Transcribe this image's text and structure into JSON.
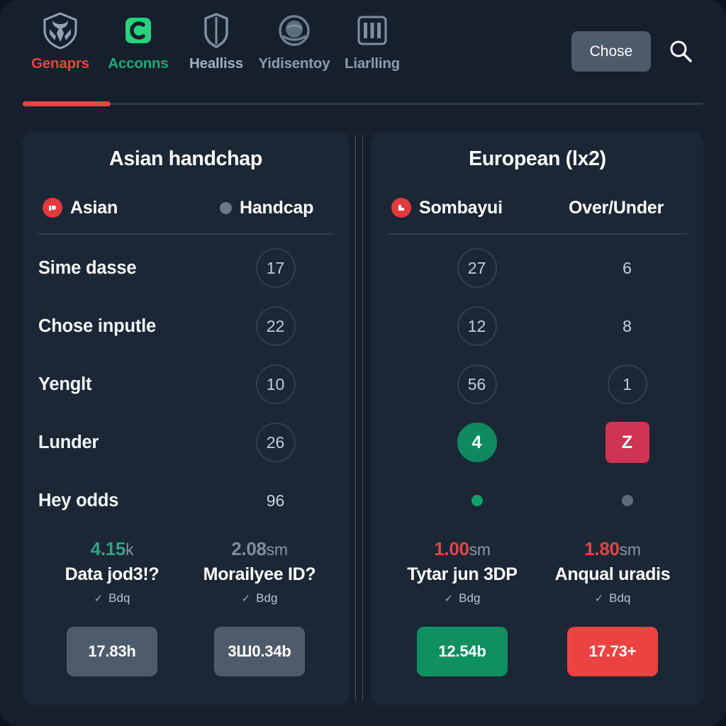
{
  "nav": {
    "tabs": [
      {
        "label": "Genaprs",
        "icon": "shield-crest-icon",
        "state": "active"
      },
      {
        "label": "Acconns",
        "icon": "letter-c-icon",
        "state": "accent"
      },
      {
        "label": "Healliss",
        "icon": "shield-outline-icon",
        "state": "plain"
      },
      {
        "label": "Yidisentoy",
        "icon": "globe-icon",
        "state": "dim"
      },
      {
        "label": "Liarlling",
        "icon": "bar-chart-icon",
        "state": "dim"
      }
    ],
    "chose_label": "Chose",
    "search_icon": "search-icon",
    "indicator_color": "#ef4440"
  },
  "panels": [
    {
      "title": "Asian handchap",
      "columns": [
        {
          "label": "Asian",
          "icon": "red-badge-icon"
        },
        {
          "label": "Handcap",
          "icon": "grey-dot-icon"
        }
      ],
      "rows": [
        {
          "label": "Sime dasse",
          "value": "17",
          "style": "circle"
        },
        {
          "label": "Chose inputle",
          "value": "22",
          "style": "circle"
        },
        {
          "label": "Yenglt",
          "value": "10",
          "style": "circle"
        },
        {
          "label": "Lunder",
          "value": "26",
          "style": "circle"
        },
        {
          "label": "Hey odds",
          "value": "96",
          "style": "plain"
        }
      ],
      "stats": [
        {
          "value": "4.15",
          "unit": "k",
          "value_color": "green",
          "title": "Data jod3!?",
          "check": "Bdq"
        },
        {
          "value": "2.08",
          "unit": "sm",
          "value_color": "grey",
          "title": "Morailyee ID?",
          "check": "Bdg"
        }
      ],
      "buttons": [
        {
          "label": "17.83h",
          "color": "grey"
        },
        {
          "label": "3Ш0.34b",
          "color": "grey"
        }
      ]
    },
    {
      "title": "European (lx2)",
      "columns": [
        {
          "label": "Sombayui",
          "icon": "red-badge-icon"
        },
        {
          "label": "Over/Under",
          "icon": "none"
        }
      ],
      "rows": [
        {
          "left": "27",
          "left_style": "circle",
          "right": "6",
          "right_style": "plain"
        },
        {
          "left": "12",
          "left_style": "circle",
          "right": "8",
          "right_style": "plain"
        },
        {
          "left": "56",
          "left_style": "circle",
          "right": "1",
          "right_style": "circle"
        },
        {
          "left": "4",
          "left_style": "circle-green",
          "right": "Z",
          "right_style": "square-red"
        },
        {
          "left": "",
          "left_style": "dot-green",
          "right": "",
          "right_style": "dot-grey"
        }
      ],
      "stats": [
        {
          "value": "1.00",
          "unit": "sm",
          "value_color": "red",
          "title": "Tytar jun 3DP",
          "check": "Bdg"
        },
        {
          "value": "1.80",
          "unit": "sm",
          "value_color": "red",
          "title": "Anqual uradis",
          "check": "Bdq"
        }
      ],
      "buttons": [
        {
          "label": "12.54b",
          "color": "green"
        },
        {
          "label": "17.73+",
          "color": "red"
        }
      ]
    }
  ]
}
